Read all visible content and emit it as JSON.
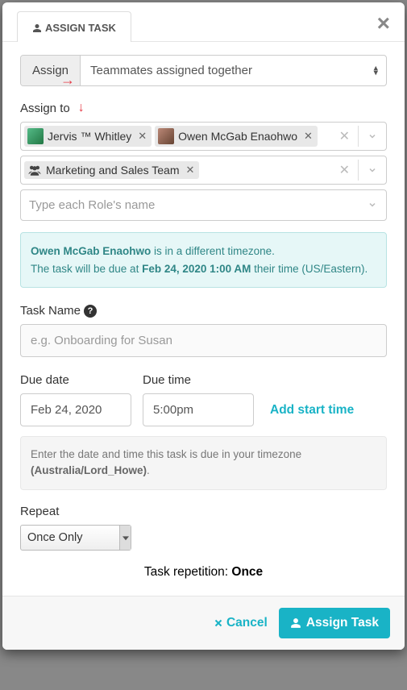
{
  "header": {
    "tab_label": "ASSIGN TASK"
  },
  "assign_mode": {
    "prefix": "Assign",
    "selected": "Teammates assigned together"
  },
  "assign_to": {
    "label": "Assign to",
    "teammates": [
      {
        "name": "Jervis ™ Whitley",
        "avatar_bg": "linear-gradient(135deg,#3a6,#284)"
      },
      {
        "name": "Owen McGab Enaohwo",
        "avatar_bg": "linear-gradient(135deg,#a67,#734)"
      }
    ],
    "groups": [
      {
        "name": "Marketing and Sales Team"
      }
    ],
    "role_placeholder": "Type each Role's name"
  },
  "timezone_notice": {
    "user": "Owen McGab Enaohwo",
    "line1_suffix": " is in a different timezone.",
    "line2_prefix": "The task will be due at ",
    "due_datetime": "Feb 24, 2020 1:00 AM",
    "line2_suffix": " their time (US/Eastern)."
  },
  "task_name": {
    "label": "Task Name",
    "placeholder": "e.g. Onboarding for Susan"
  },
  "due": {
    "date_label": "Due date",
    "date_value": "Feb 24, 2020",
    "time_label": "Due time",
    "time_value": "5:00pm",
    "add_start_label": "Add start time"
  },
  "timezone_hint": {
    "line1": "Enter the date and time this task is due in your timezone",
    "tz": "(Australia/Lord_Howe)",
    "suffix": "."
  },
  "repeat": {
    "label": "Repeat",
    "selected": "Once Only",
    "summary_prefix": "Task repetition: ",
    "summary_value": "Once"
  },
  "footer": {
    "cancel": "Cancel",
    "submit": "Assign Task"
  }
}
